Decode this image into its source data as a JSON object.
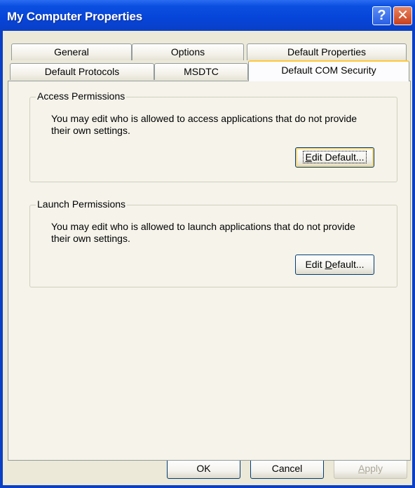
{
  "window": {
    "title": "My Computer Properties",
    "help_glyph": "?",
    "close_glyph": "✕"
  },
  "tabs": {
    "row_back": [
      {
        "label": "General"
      },
      {
        "label": "Options"
      },
      {
        "label": "Default Properties"
      }
    ],
    "row_front": [
      {
        "label": "Default Protocols"
      },
      {
        "label": "MSDTC"
      },
      {
        "label": "Default COM Security",
        "selected": true
      }
    ]
  },
  "access": {
    "label": "Access Permissions",
    "description": "You may edit who is allowed to access applications that do not provide their own settings.",
    "button_prefix": "E",
    "button_rest": "dit Default..."
  },
  "launch": {
    "label": "Launch Permissions",
    "description": "You may edit who is allowed to launch applications that do not provide their own settings.",
    "button_prefix": "Edit ",
    "button_underline": "D",
    "button_rest": "efault..."
  },
  "footer": {
    "ok": "OK",
    "cancel": "Cancel",
    "apply_underline": "A",
    "apply_rest": "pply"
  },
  "colors": {
    "titlebar": "#0a3fc6",
    "dialog": "#ece9d8",
    "active_tab_accent": "#ffc83c"
  }
}
